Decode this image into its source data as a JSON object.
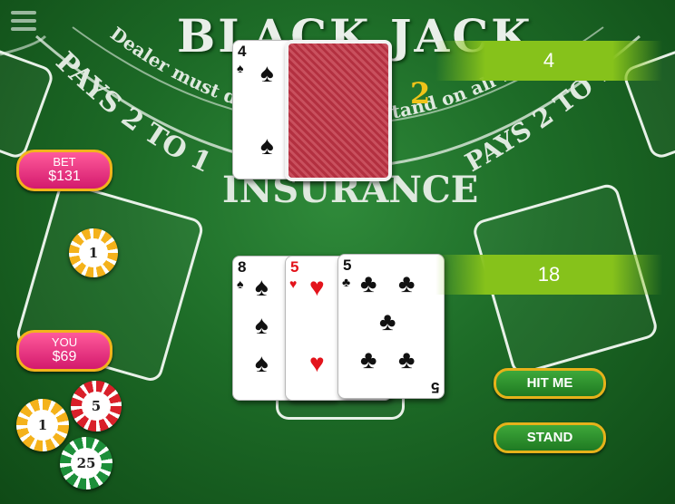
{
  "table": {
    "title": "BLACK JACK",
    "subtitle_number": "2",
    "arc_text": "Dealer must draw on 16 and stand on all 17s",
    "pays_left": "PAYS 2 TO 1",
    "pays_right": "PAYS 2 TO 1",
    "insurance": "INSURANCE"
  },
  "dealer": {
    "score": "4",
    "up_card": {
      "rank": "4",
      "suit": "♠",
      "color": "black"
    }
  },
  "player": {
    "score": "18",
    "cards": [
      {
        "rank": "8",
        "suit": "♠",
        "color": "black"
      },
      {
        "rank": "5",
        "suit": "♥",
        "color": "red"
      },
      {
        "rank": "5",
        "suit": "♣",
        "color": "black"
      }
    ]
  },
  "bet": {
    "label": "BET",
    "value": "$131"
  },
  "you": {
    "label": "YOU",
    "value": "$69"
  },
  "chips": {
    "bet_chip": "1",
    "chip_1": "1",
    "chip_5": "5",
    "chip_25": "25"
  },
  "buttons": {
    "hit": "HIT ME",
    "stand": "STAND"
  },
  "colors": {
    "felt": "#1d6b27",
    "pill": "#e8317f",
    "banner": "#86c21b",
    "button": "#2d8f2d",
    "gold": "#f0c419"
  }
}
